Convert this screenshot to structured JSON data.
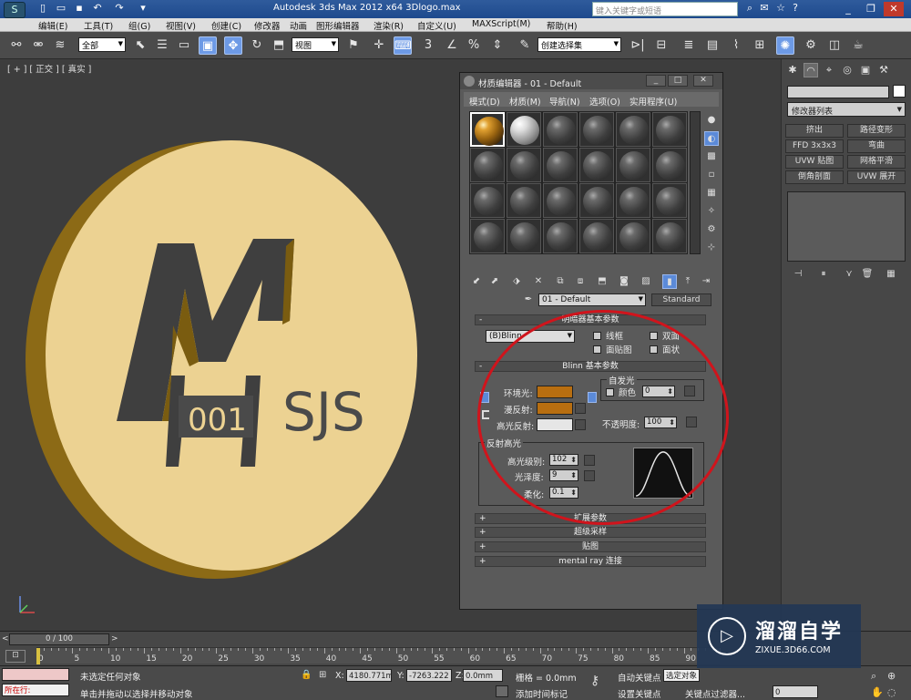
{
  "app": {
    "title": "Autodesk 3ds Max  2012 x64    3Dlogo.max",
    "search_placeholder": "键入关键字或短语"
  },
  "menus": [
    "编辑(E)",
    "工具(T)",
    "组(G)",
    "视图(V)",
    "创建(C)",
    "修改器",
    "动画",
    "图形编辑器",
    "渲染(R)",
    "自定义(U)",
    "MAXScript(M)",
    "帮助(H)"
  ],
  "toolbar": {
    "selection_filter": "全部",
    "ref_coord": "视图",
    "named_selection": "创建选择集"
  },
  "viewport": {
    "label": "[ + ] [ 正交 ] [ 真实 ]",
    "logo_text": "SJS",
    "logo_number": "001"
  },
  "command_panel": {
    "modifier_list": "修改器列表",
    "buttons": [
      "挤出",
      "路径变形",
      "FFD 3x3x3",
      "弯曲",
      "UVW 贴图",
      "网格平滑",
      "倒角剖面",
      "UVW 展开"
    ]
  },
  "material_editor": {
    "title": "材质编辑器 - 01 - Default",
    "menu": [
      "模式(D)",
      "材质(M)",
      "导航(N)",
      "选项(O)",
      "实用程序(U)"
    ],
    "material_name": "01 - Default",
    "material_type": "Standard",
    "rollout_shader_basic": "明暗器基本参数",
    "shader": "(B)Blinn",
    "wire": "线框",
    "two_sided": "双面",
    "face_map": "面贴图",
    "faceted": "面状",
    "rollout_blinn": "Blinn 基本参数",
    "self_illum_group": "自发光",
    "self_illum_color": "颜色",
    "self_illum_value": "0",
    "ambient": "环境光:",
    "diffuse": "漫反射:",
    "specular": "高光反射:",
    "opacity_label": "不透明度:",
    "opacity_value": "100",
    "spec_group": "反射高光",
    "spec_level_label": "高光级别:",
    "spec_level": "102",
    "glossiness_label": "光泽度:",
    "glossiness": "9",
    "soften_label": "柔化:",
    "soften": "0.1",
    "rollout_extended": "扩展参数",
    "rollout_supersampling": "超级采样",
    "rollout_maps": "贴图",
    "rollout_mentalray": "mental ray 连接",
    "colors": {
      "ambient": "#b86e10",
      "diffuse": "#b86e10",
      "specular": "#e6e6e6"
    }
  },
  "timeline": {
    "frame": "0 / 100",
    "ticks": [
      "0",
      "5",
      "10",
      "15",
      "20",
      "25",
      "30",
      "35",
      "40",
      "45",
      "50",
      "55",
      "60",
      "65",
      "70",
      "75",
      "80",
      "85",
      "90"
    ]
  },
  "status": {
    "listener": "所在行:",
    "selection": "未选定任何对象",
    "prompt": "单击并拖动以选择并移动对象",
    "x_label": "X:",
    "x_value": "4180.771m",
    "y_label": "Y:",
    "y_value": "-7263.222",
    "z_label": "Z:",
    "z_value": "0.0mm",
    "grid": "栅格 = 0.0mm",
    "add_key": "添加时间标记",
    "auto_key": "自动关键点",
    "selected_object": "选定对象",
    "set_key": "设置关键点",
    "key_filter": "关键点过滤器...",
    "frame_value": "0"
  },
  "watermark": {
    "brand": "溜溜自学",
    "url": "ZIXUE.3D66.COM"
  }
}
